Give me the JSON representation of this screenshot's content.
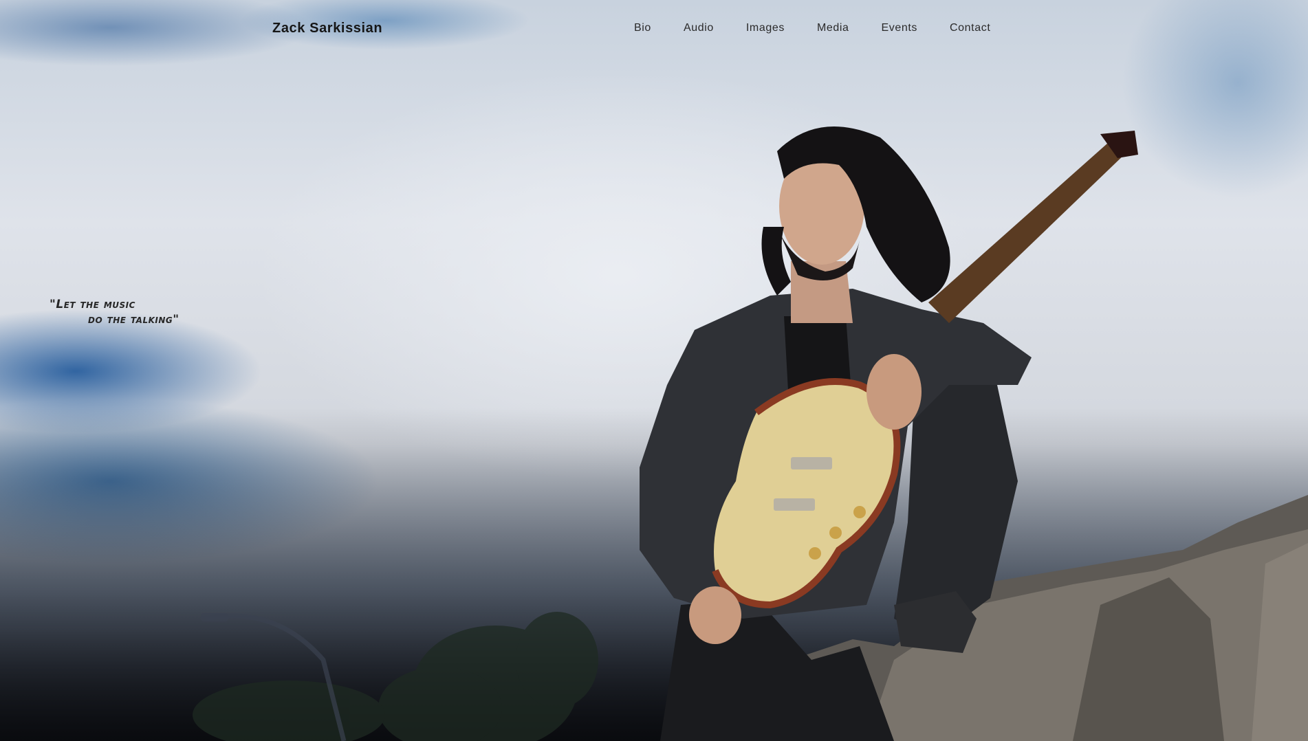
{
  "site": {
    "brand": "Zack Sarkissian"
  },
  "nav": {
    "items": [
      {
        "label": "Bio"
      },
      {
        "label": "Audio"
      },
      {
        "label": "Images"
      },
      {
        "label": "Media"
      },
      {
        "label": "Events"
      },
      {
        "label": "Contact"
      }
    ]
  },
  "hero": {
    "quote_line1": "\"Let the music",
    "quote_line2": "do the talking\""
  },
  "colors": {
    "text_dark": "#161616",
    "sky": "#dfe3ea",
    "sky_blue": "#2a6aa8",
    "ground": "#20242c"
  }
}
